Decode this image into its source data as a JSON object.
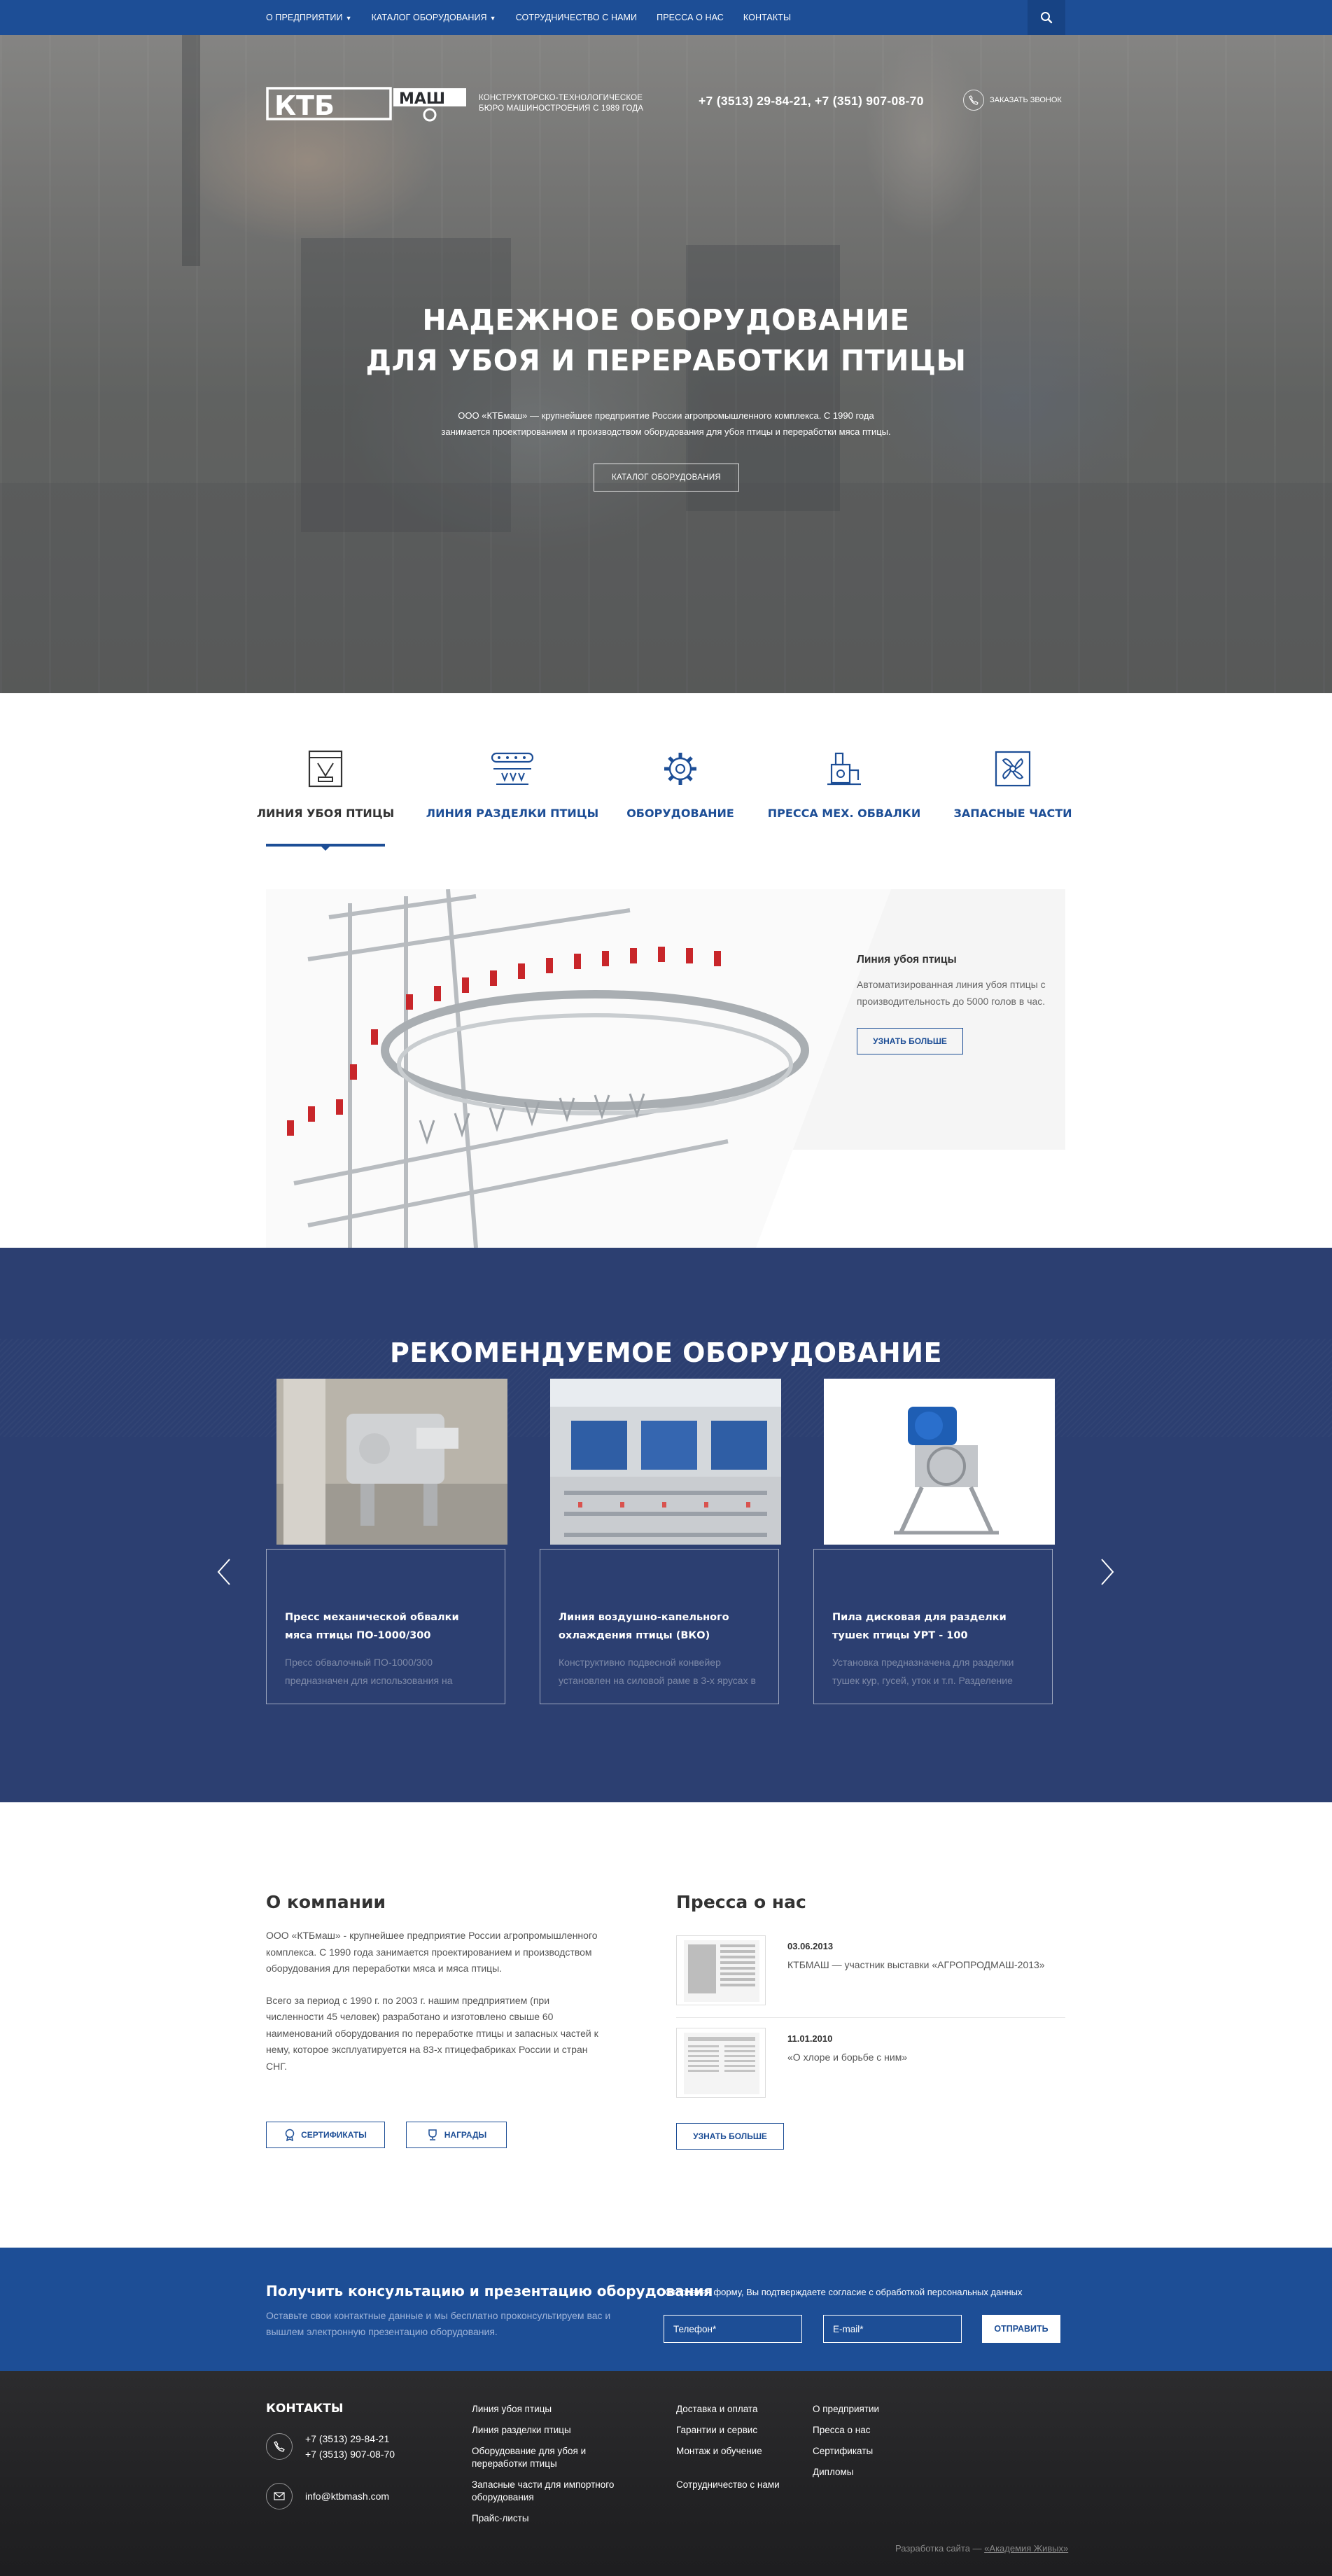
{
  "nav": {
    "items": [
      {
        "label": "О ПРЕДПРИЯТИИ",
        "dropdown": true
      },
      {
        "label": "КАТАЛОГ ОБОРУДОВАНИЯ",
        "dropdown": true
      },
      {
        "label": "СОТРУДНИЧЕСТВО С НАМИ",
        "dropdown": false
      },
      {
        "label": "ПРЕССА О НАС",
        "dropdown": false
      },
      {
        "label": "КОНТАКТЫ",
        "dropdown": false
      }
    ],
    "search_icon": "search-icon"
  },
  "header": {
    "logo_ktb": "КТБ",
    "logo_mash": "МАШ",
    "logo_line1": "КОНСТРУКТОРСКО-ТЕХНОЛОГИЧЕСКОЕ",
    "logo_line2": "БЮРО МАШИНОСТРОЕНИЯ С 1989 ГОДА",
    "phones": "+7 (3513) 29-84-21, +7 (351) 907-08-70",
    "callback": "ЗАКАЗАТЬ ЗВОНОК"
  },
  "hero": {
    "title_line1": "НАДЕЖНОЕ ОБОРУДОВАНИЕ",
    "title_line2": "ДЛЯ УБОЯ И ПЕРЕРАБОТКИ ПТИЦЫ",
    "lead_line1": "ООО «КТБмаш» — крупнейшее предприятие России агропромышленного комплекса. С 1990 года",
    "lead_line2": "занимается проектированием и производством оборудования для убоя птицы и переработки мяса птицы.",
    "cta": "КАТАЛОГ ОБОРУДОВАНИЯ"
  },
  "tabs": [
    {
      "label": "ЛИНИЯ УБОЯ ПТИЦЫ",
      "icon": "slaughter-line-icon",
      "active": true
    },
    {
      "label": "ЛИНИЯ РАЗДЕЛКИ ПТИЦЫ",
      "icon": "conveyor-icon",
      "active": false
    },
    {
      "label": "ОБОРУДОВАНИЕ",
      "icon": "gear-icon",
      "active": false
    },
    {
      "label": "ПРЕССА МЕХ. ОБВАЛКИ",
      "icon": "press-icon",
      "active": false
    },
    {
      "label": "ЗАПАСНЫЕ ЧАСТИ",
      "icon": "fan-icon",
      "active": false
    }
  ],
  "feature": {
    "title": "Линия убоя птицы",
    "text": "Автоматизированная линия убоя птицы с производительность до 5000 голов в час.",
    "button": "УЗНАТЬ БОЛЬШЕ"
  },
  "recommended": {
    "title": "РЕКОМЕНДУЕМОЕ ОБОРУДОВАНИЕ",
    "cards": [
      {
        "title": "Пресс механической обвалки мяса птицы ПО-1000/300",
        "text": "Пресс обвалочный ПО-1000/300 предназначен для использования на"
      },
      {
        "title": "Линия воздушно-капельного охлаждения птицы (ВКО)",
        "text": "Конструктивно подвесной конвейер установлен на силовой раме в 3-х ярусах в"
      },
      {
        "title": "Пила дисковая для разделки тушек птицы УРТ - 100",
        "text": "Установка предназначена для разделки тушек кур, гусей, уток и т.п. Разделение"
      }
    ]
  },
  "about": {
    "title": "О компании",
    "p1": "ООО «КТБмаш» - крупнейшее предприятие России агропромышленного комплекса. С 1990 года занимается проектированием и производством оборудования для переработки мяса и мяса птицы.",
    "p2": "Всего за период с 1990 г. по 2003 г. нашим предприятием (при численности 45 человек) разработано и изготовлено свыше 60 наименований оборудования по переработке птицы и запасных частей к нему, которое эксплуатируется на 83-х птицефабриках России и стран СНГ.",
    "btn_certificates": "СЕРТИФИКАТЫ",
    "btn_awards": "НАГРАДЫ"
  },
  "press": {
    "title": "Пресса о нас",
    "items": [
      {
        "date": "03.06.2013",
        "title": "КТБМАШ — участник выставки «АГРОПРОДМАШ-2013»"
      },
      {
        "date": "11.01.2010",
        "title": "«О хлоре и борьбе с ним»"
      }
    ],
    "button": "УЗНАТЬ БОЛЬШЕ"
  },
  "subscribe": {
    "title": "Получить консультацию и презентацию оборудования",
    "desc": "Оставьте свои контактные данные и мы бесплатно проконсультируем вас и вышлем электронную презентацию оборудования.",
    "consent": "Отправляя форму, Вы подтверждаете согласие с обработкой персональных данных",
    "phone_placeholder": "Телефон*",
    "email_placeholder": "E-mail*",
    "send": "ОТПРАВИТЬ"
  },
  "footer": {
    "title": "КОНТАКТЫ",
    "phone1": "+7 (3513) 29-84-21",
    "phone2": "+7 (3513) 907-08-70",
    "email": "info@ktbmash.com",
    "col1": [
      "Линия убоя птицы",
      "Линия разделки птицы",
      "Оборудование для убоя и переработки птицы",
      "Запасные части для импортного оборудования",
      "Прайс-листы"
    ],
    "col2": [
      "Доставка и оплата",
      "Гарантии и сервис",
      "Монтаж и обучение",
      "Сотрудничество с нами"
    ],
    "col3": [
      "О предприятии",
      "Пресса о нас",
      "Сертификаты",
      "Дипломы"
    ],
    "credit_prefix": "Разработка сайта —",
    "credit_link": "«Академия Живых»"
  },
  "colors": {
    "brand_blue": "#1d4e96",
    "navy_section": "#2c3f71",
    "footer_dark": "#222224"
  }
}
